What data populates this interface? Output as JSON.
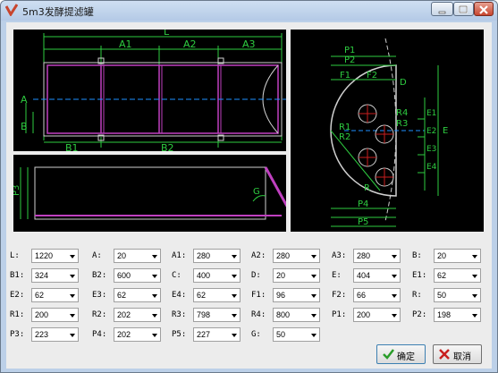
{
  "window": {
    "title": "5m3发酵提滤罐",
    "accent": "#c8452e"
  },
  "drawing": {
    "top_labels": [
      "L",
      "A1",
      "A2",
      "A3",
      "A",
      "B",
      "B1",
      "B2"
    ],
    "side_labels": [
      "P3",
      "G"
    ],
    "right_labels": [
      "P1",
      "P2",
      "F1",
      "F2",
      "D",
      "R4",
      "R1",
      "R2",
      "R3",
      "E1",
      "E2",
      "E3",
      "E4",
      "E",
      "P4",
      "P5",
      "R"
    ]
  },
  "fields": [
    {
      "label": "L:",
      "value": "1220"
    },
    {
      "label": "A:",
      "value": "20"
    },
    {
      "label": "A1:",
      "value": "280"
    },
    {
      "label": "A2:",
      "value": "280"
    },
    {
      "label": "A3:",
      "value": "280"
    },
    {
      "label": "B:",
      "value": "20"
    },
    {
      "label": "B1:",
      "value": "324"
    },
    {
      "label": "B2:",
      "value": "600"
    },
    {
      "label": "C:",
      "value": "400"
    },
    {
      "label": "D:",
      "value": "20"
    },
    {
      "label": "E:",
      "value": "404"
    },
    {
      "label": "E1:",
      "value": "62"
    },
    {
      "label": "E2:",
      "value": "62"
    },
    {
      "label": "E3:",
      "value": "62"
    },
    {
      "label": "E4:",
      "value": "62"
    },
    {
      "label": "F1:",
      "value": "96"
    },
    {
      "label": "F2:",
      "value": "66"
    },
    {
      "label": "R:",
      "value": "50"
    },
    {
      "label": "R1:",
      "value": "200"
    },
    {
      "label": "R2:",
      "value": "202"
    },
    {
      "label": "R3:",
      "value": "798"
    },
    {
      "label": "R4:",
      "value": "800"
    },
    {
      "label": "P1:",
      "value": "200"
    },
    {
      "label": "P2:",
      "value": "198"
    },
    {
      "label": "P3:",
      "value": "223"
    },
    {
      "label": "P4:",
      "value": "202"
    },
    {
      "label": "P5:",
      "value": "227"
    },
    {
      "label": "G:",
      "value": "50"
    }
  ],
  "buttons": {
    "ok_label": "确定",
    "cancel_label": "取消"
  }
}
